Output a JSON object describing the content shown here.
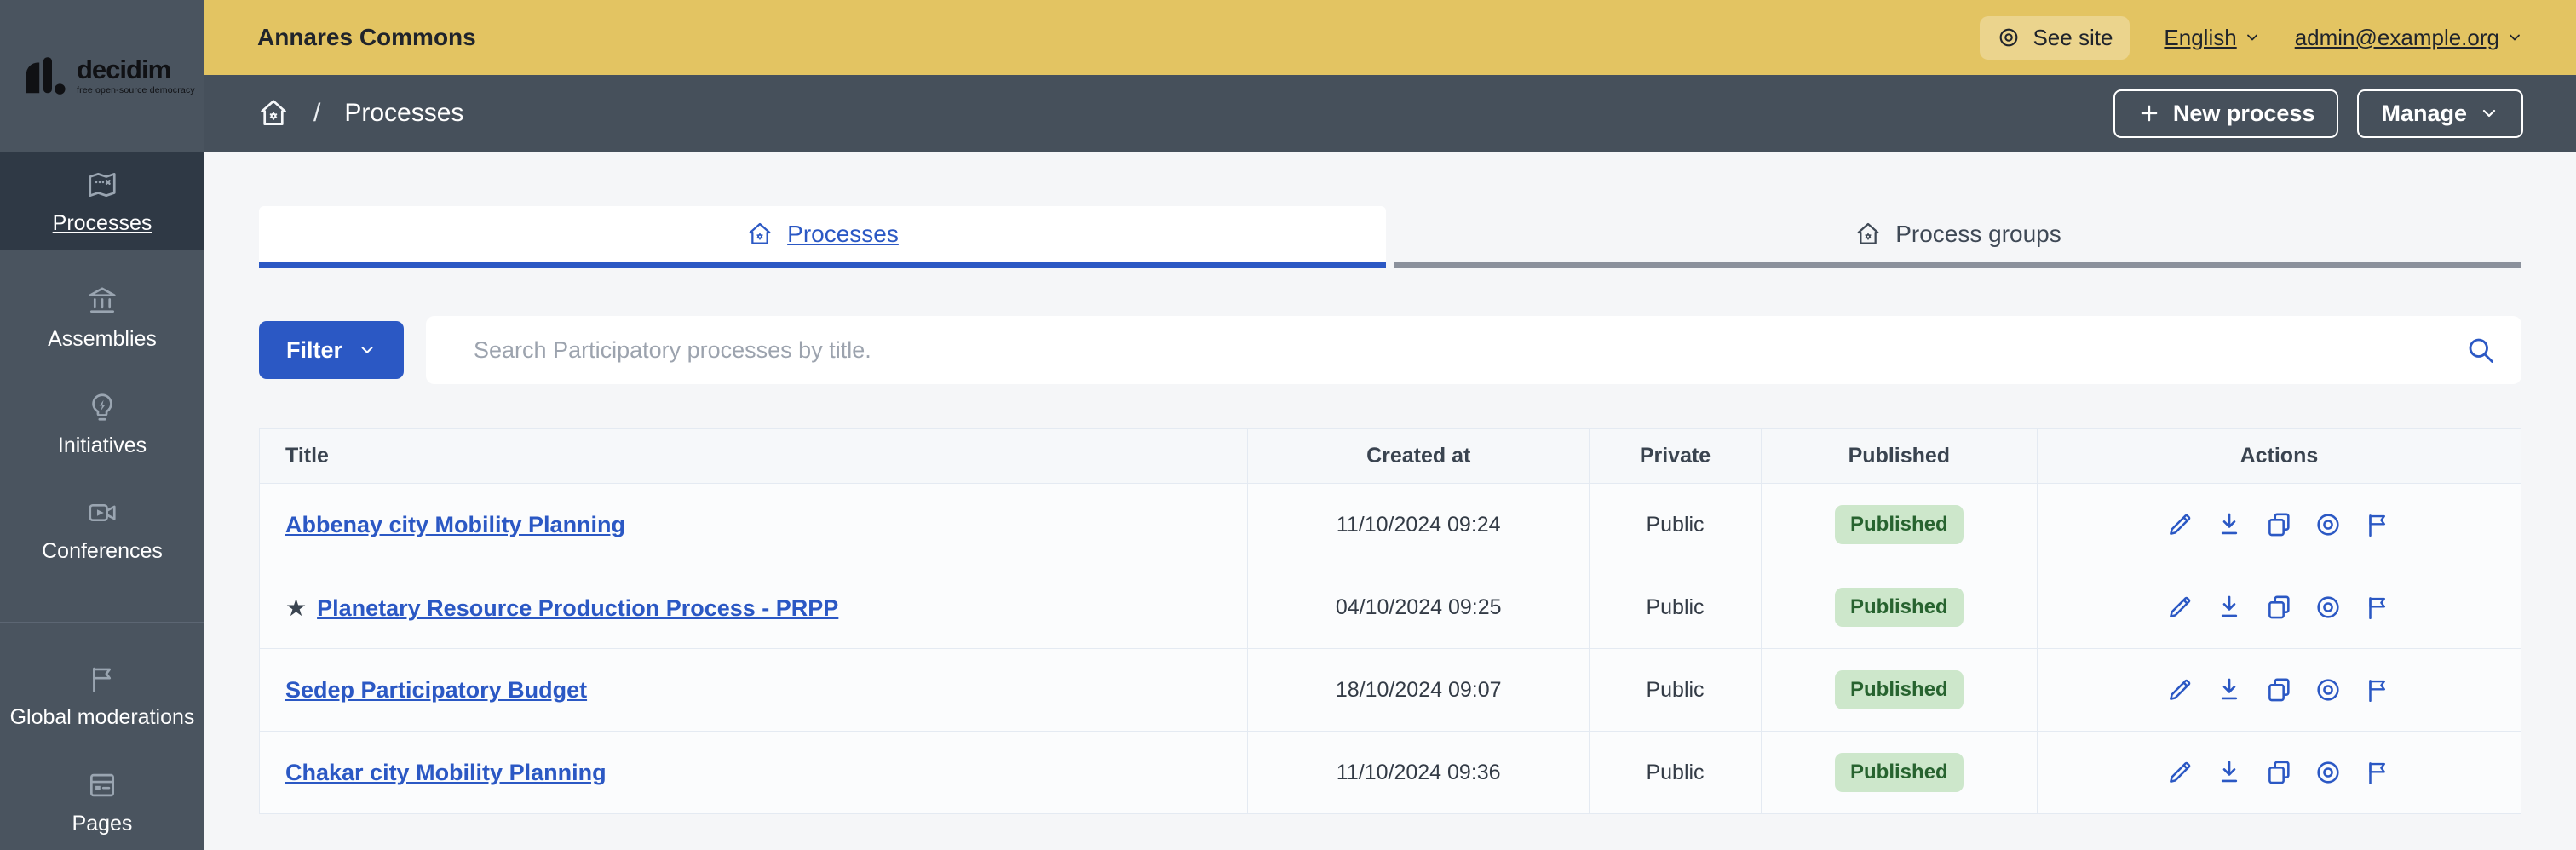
{
  "topbar": {
    "site_name": "Annares Commons",
    "see_site_label": "See site",
    "language_label": "English",
    "account_label": "admin@example.org"
  },
  "breadcrumb": {
    "separator": "/",
    "current_page": "Processes",
    "new_process_label": "New process",
    "manage_label": "Manage"
  },
  "sidebar": {
    "logo": {
      "name": "decidim",
      "tagline": "free open-source democracy"
    },
    "items": [
      {
        "label": "Processes",
        "icon": "map-icon",
        "active": true
      },
      {
        "label": "Assemblies",
        "icon": "bank-icon",
        "active": false
      },
      {
        "label": "Initiatives",
        "icon": "lightbulb-icon",
        "active": false
      },
      {
        "label": "Conferences",
        "icon": "video-camera-icon",
        "active": false
      },
      {
        "label": "Global moderations",
        "icon": "flag-icon",
        "active": false
      },
      {
        "label": "Pages",
        "icon": "pages-icon",
        "active": false
      }
    ]
  },
  "tabs": [
    {
      "label": "Processes",
      "icon": "home-icon",
      "active": true
    },
    {
      "label": "Process groups",
      "icon": "home-icon",
      "active": false
    }
  ],
  "filters": {
    "filter_button_label": "Filter",
    "search_placeholder": "Search Participatory processes by title."
  },
  "table": {
    "headers": [
      "Title",
      "Created at",
      "Private",
      "Published",
      "Actions"
    ],
    "action_icons": [
      "edit-pencil-icon",
      "download-icon",
      "duplicate-icon",
      "preview-eye-icon",
      "flag-icon"
    ],
    "rows": [
      {
        "title": "Abbenay city Mobility Planning",
        "starred": false,
        "created_at": "11/10/2024 09:24",
        "private": "Public",
        "published": "Published"
      },
      {
        "title": "Planetary Resource Production Process - PRPP",
        "starred": true,
        "created_at": "04/10/2024 09:25",
        "private": "Public",
        "published": "Published"
      },
      {
        "title": "Sedep Participatory Budget",
        "starred": false,
        "created_at": "18/10/2024 09:07",
        "private": "Public",
        "published": "Published"
      },
      {
        "title": "Chakar city Mobility Planning",
        "starred": false,
        "created_at": "11/10/2024 09:36",
        "private": "Public",
        "published": "Published"
      }
    ]
  },
  "colors": {
    "accent_blue": "#2b58c4",
    "topbar_gold": "#e3c462",
    "sidebar_slate": "#4a545f",
    "sidebar_active": "#2f3945",
    "badge_green_bg": "#cde7cb",
    "badge_green_text": "#27632f",
    "inactive_tab_gray": "#8b919c"
  }
}
